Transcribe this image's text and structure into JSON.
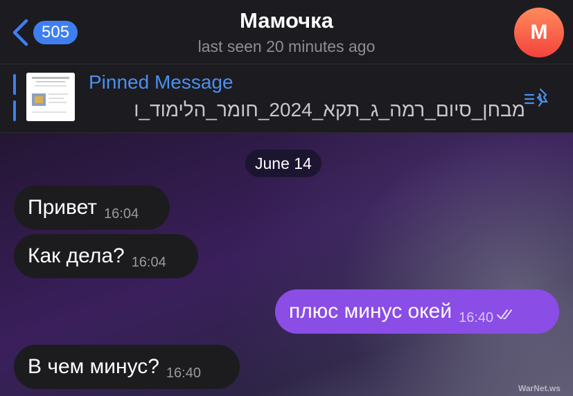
{
  "header": {
    "back_count": "505",
    "title": "Мамочка",
    "subtitle": "last seen 20 minutes ago",
    "avatar_letter": "M"
  },
  "pinned": {
    "label": "Pinned Message",
    "text": "מבחן_סיום_רמה_ג_תקא_2024_חומר_הלימוד_ו"
  },
  "chat": {
    "date": "June 14",
    "messages": [
      {
        "text": "Привет",
        "time": "16:04",
        "direction": "incoming"
      },
      {
        "text": "Как дела?",
        "time": "16:04",
        "direction": "incoming"
      },
      {
        "text": "плюс минус окей",
        "time": "16:40",
        "direction": "outgoing",
        "status": "read"
      },
      {
        "text": "В чем минус?",
        "time": "16:40",
        "direction": "incoming"
      }
    ]
  },
  "watermark": "WarNet.ws",
  "colors": {
    "accent": "#3e7ff0",
    "outgoing_bubble": "#8a4de6",
    "incoming_bubble": "#1c1c1e"
  }
}
